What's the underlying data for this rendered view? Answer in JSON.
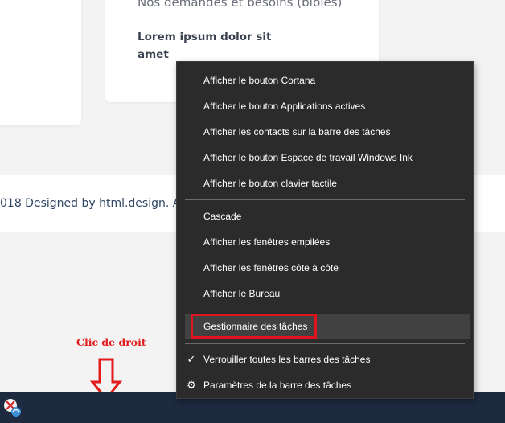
{
  "page": {
    "card_subtitle": "Nos demandes et besoins (bibles)",
    "card_text": "Lorem ipsum dolor sit amet",
    "footer_copyright": "018 Designed by html.design. All"
  },
  "annotation": {
    "label": "Clic de droit",
    "color": "#e21b1b"
  },
  "taskbar": {
    "color": "#1d2a3f",
    "app_icon": "app-icon"
  },
  "context_menu": {
    "group1": [
      "Afficher le bouton Cortana",
      "Afficher le bouton Applications actives",
      "Afficher les contacts sur la barre des tâches",
      "Afficher le bouton Espace de travail Windows Ink",
      "Afficher le bouton clavier tactile"
    ],
    "group2": [
      "Cascade",
      "Afficher les fenêtres empilées",
      "Afficher les fenêtres côte à côte",
      "Afficher le Bureau"
    ],
    "task_manager": "Gestionnaire des tâches",
    "lock_taskbars": "Verrouiller toutes les barres des tâches",
    "lock_checked": true,
    "settings": "Paramètres de la barre des tâches",
    "highlight_color": "#e0141e"
  }
}
